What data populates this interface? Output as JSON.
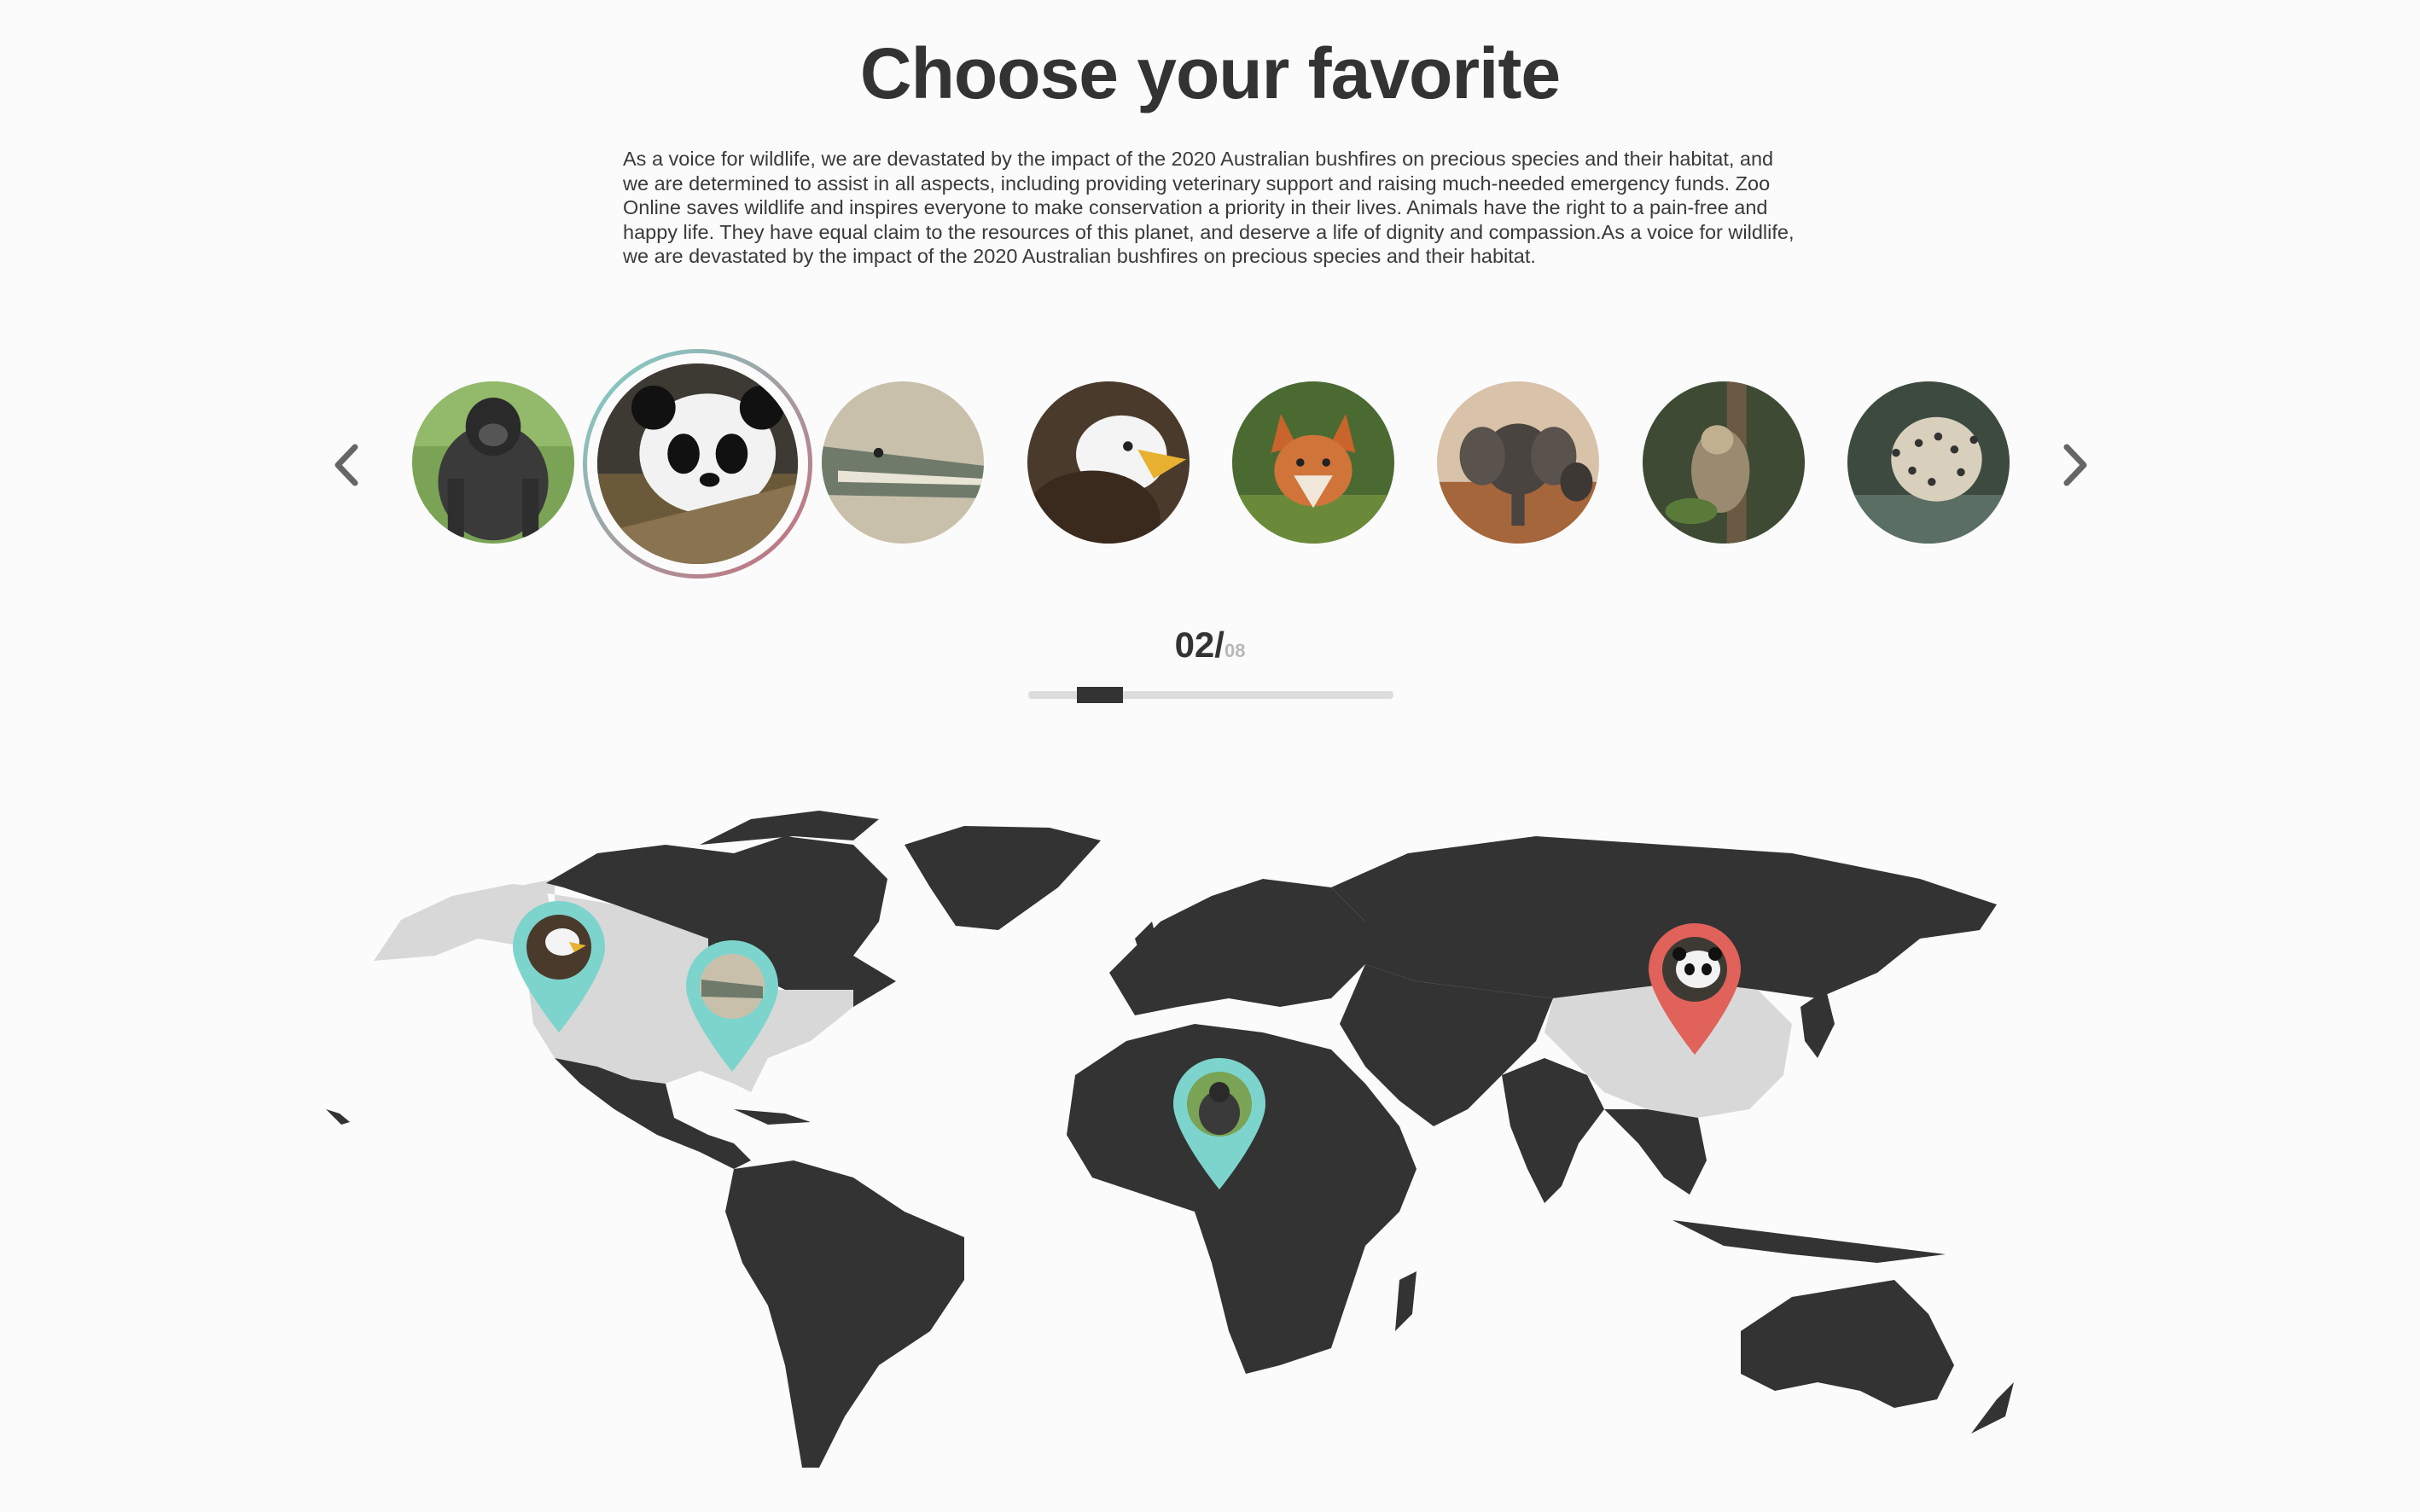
{
  "page": {
    "title": "Choose your favorite",
    "intro": "As a voice for wildlife, we are devastated by the impact of the 2020 Australian bushfires on precious species and their habitat, and we are determined to assist in all aspects, including providing veterinary support and raising much-needed emergency funds. Zoo Online saves wildlife and inspires everyone to make conservation a priority in their lives. Animals have the right to a pain-free and happy life. They have equal claim to the resources of this planet, and deserve a life of dignity and compassion.As a voice for wildlife, we are devastated by the impact of the 2020 Australian bushfires on precious species and their habitat."
  },
  "carousel": {
    "prev_icon": "chevron-left-icon",
    "next_icon": "chevron-right-icon",
    "animals": [
      "gorilla",
      "panda",
      "crocodile",
      "bald-eagle",
      "fox",
      "elephant",
      "sloth",
      "leopard"
    ],
    "selected_index": 1,
    "current": "02/",
    "total": "08",
    "progress_fraction": 0.125
  },
  "map": {
    "land_color": "#333333",
    "highlight_color": "#d8d8d8",
    "pins": [
      {
        "animal": "bald-eagle",
        "region": "Canada",
        "color": "#7dd4cc"
      },
      {
        "animal": "crocodile",
        "region": "United States",
        "color": "#7dd4cc"
      },
      {
        "animal": "gorilla",
        "region": "Central Africa",
        "color": "#7dd4cc"
      },
      {
        "animal": "panda",
        "region": "China",
        "color": "#e0625a",
        "active": true
      }
    ]
  }
}
